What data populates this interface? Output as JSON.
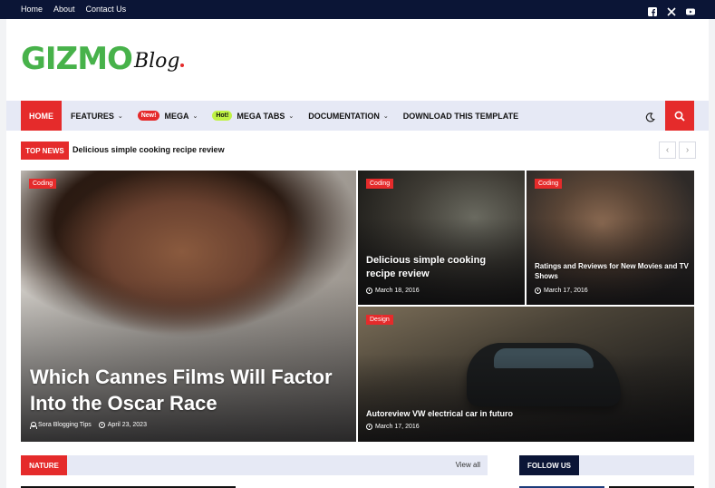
{
  "topbar": {
    "links": [
      "Home",
      "About",
      "Contact Us"
    ],
    "social_icons": [
      "facebook-icon",
      "x-twitter-icon",
      "youtube-icon"
    ],
    "bg_color": "#0b1536"
  },
  "logo": {
    "main": "GIZMO",
    "script": "Blog",
    "main_color": "#47b24a",
    "dot_color": "#e52b2b"
  },
  "nav": {
    "home": "HOME",
    "items": [
      {
        "label": "FEATURES",
        "badge": "",
        "has_dropdown": true
      },
      {
        "label": "MEGA",
        "badge": "New!",
        "has_dropdown": true
      },
      {
        "label": "MEGA TABS",
        "badge": "Hot!",
        "has_dropdown": true
      },
      {
        "label": "DOCUMENTATION",
        "badge": "",
        "has_dropdown": true
      },
      {
        "label": "DOWNLOAD THIS TEMPLATE",
        "badge": "",
        "has_dropdown": false
      }
    ],
    "accent": "#e52b2b"
  },
  "ticker": {
    "label": "TOP NEWS",
    "text": "Delicious simple cooking recipe review",
    "prev": "‹",
    "next": "›"
  },
  "featured": [
    {
      "category": "Coding",
      "title": "Which Cannes Films Will Factor Into the Oscar Race",
      "author": "Sora Blogging Tips",
      "date": "April 23, 2023"
    },
    {
      "category": "Coding",
      "title": "Delicious simple cooking recipe review",
      "date": "March 18, 2016"
    },
    {
      "category": "Coding",
      "title": "Ratings and Reviews for New Movies and TV Shows",
      "date": "March 17, 2016"
    },
    {
      "category": "Design",
      "title": "Autoreview VW electrical car in futuro",
      "date": "March 17, 2016"
    }
  ],
  "sections": {
    "nature": {
      "label": "NATURE",
      "view_all": "View all"
    },
    "follow": {
      "label": "FOLLOW US"
    }
  }
}
